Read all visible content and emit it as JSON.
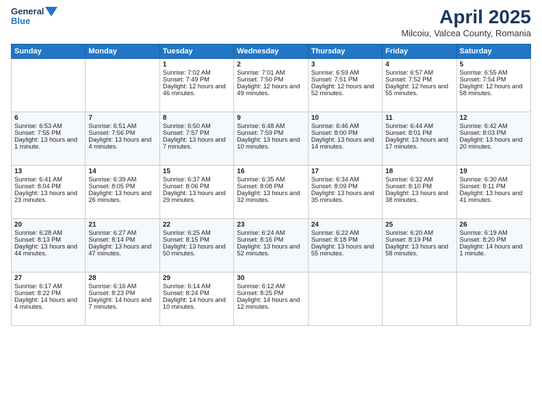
{
  "logo": {
    "line1": "General",
    "line2": "Blue"
  },
  "title": "April 2025",
  "location": "Milcoiu, Valcea County, Romania",
  "days_of_week": [
    "Sunday",
    "Monday",
    "Tuesday",
    "Wednesday",
    "Thursday",
    "Friday",
    "Saturday"
  ],
  "weeks": [
    [
      {
        "day": "",
        "sunrise": "",
        "sunset": "",
        "daylight": ""
      },
      {
        "day": "",
        "sunrise": "",
        "sunset": "",
        "daylight": ""
      },
      {
        "day": "1",
        "sunrise": "Sunrise: 7:02 AM",
        "sunset": "Sunset: 7:49 PM",
        "daylight": "Daylight: 12 hours and 46 minutes."
      },
      {
        "day": "2",
        "sunrise": "Sunrise: 7:01 AM",
        "sunset": "Sunset: 7:50 PM",
        "daylight": "Daylight: 12 hours and 49 minutes."
      },
      {
        "day": "3",
        "sunrise": "Sunrise: 6:59 AM",
        "sunset": "Sunset: 7:51 PM",
        "daylight": "Daylight: 12 hours and 52 minutes."
      },
      {
        "day": "4",
        "sunrise": "Sunrise: 6:57 AM",
        "sunset": "Sunset: 7:52 PM",
        "daylight": "Daylight: 12 hours and 55 minutes."
      },
      {
        "day": "5",
        "sunrise": "Sunrise: 6:55 AM",
        "sunset": "Sunset: 7:54 PM",
        "daylight": "Daylight: 12 hours and 58 minutes."
      }
    ],
    [
      {
        "day": "6",
        "sunrise": "Sunrise: 6:53 AM",
        "sunset": "Sunset: 7:55 PM",
        "daylight": "Daylight: 13 hours and 1 minute."
      },
      {
        "day": "7",
        "sunrise": "Sunrise: 6:51 AM",
        "sunset": "Sunset: 7:56 PM",
        "daylight": "Daylight: 13 hours and 4 minutes."
      },
      {
        "day": "8",
        "sunrise": "Sunrise: 6:50 AM",
        "sunset": "Sunset: 7:57 PM",
        "daylight": "Daylight: 13 hours and 7 minutes."
      },
      {
        "day": "9",
        "sunrise": "Sunrise: 6:48 AM",
        "sunset": "Sunset: 7:59 PM",
        "daylight": "Daylight: 13 hours and 10 minutes."
      },
      {
        "day": "10",
        "sunrise": "Sunrise: 6:46 AM",
        "sunset": "Sunset: 8:00 PM",
        "daylight": "Daylight: 13 hours and 14 minutes."
      },
      {
        "day": "11",
        "sunrise": "Sunrise: 6:44 AM",
        "sunset": "Sunset: 8:01 PM",
        "daylight": "Daylight: 13 hours and 17 minutes."
      },
      {
        "day": "12",
        "sunrise": "Sunrise: 6:42 AM",
        "sunset": "Sunset: 8:03 PM",
        "daylight": "Daylight: 13 hours and 20 minutes."
      }
    ],
    [
      {
        "day": "13",
        "sunrise": "Sunrise: 6:41 AM",
        "sunset": "Sunset: 8:04 PM",
        "daylight": "Daylight: 13 hours and 23 minutes."
      },
      {
        "day": "14",
        "sunrise": "Sunrise: 6:39 AM",
        "sunset": "Sunset: 8:05 PM",
        "daylight": "Daylight: 13 hours and 26 minutes."
      },
      {
        "day": "15",
        "sunrise": "Sunrise: 6:37 AM",
        "sunset": "Sunset: 8:06 PM",
        "daylight": "Daylight: 13 hours and 29 minutes."
      },
      {
        "day": "16",
        "sunrise": "Sunrise: 6:35 AM",
        "sunset": "Sunset: 8:08 PM",
        "daylight": "Daylight: 13 hours and 32 minutes."
      },
      {
        "day": "17",
        "sunrise": "Sunrise: 6:34 AM",
        "sunset": "Sunset: 8:09 PM",
        "daylight": "Daylight: 13 hours and 35 minutes."
      },
      {
        "day": "18",
        "sunrise": "Sunrise: 6:32 AM",
        "sunset": "Sunset: 8:10 PM",
        "daylight": "Daylight: 13 hours and 38 minutes."
      },
      {
        "day": "19",
        "sunrise": "Sunrise: 6:30 AM",
        "sunset": "Sunset: 8:11 PM",
        "daylight": "Daylight: 13 hours and 41 minutes."
      }
    ],
    [
      {
        "day": "20",
        "sunrise": "Sunrise: 6:28 AM",
        "sunset": "Sunset: 8:13 PM",
        "daylight": "Daylight: 13 hours and 44 minutes."
      },
      {
        "day": "21",
        "sunrise": "Sunrise: 6:27 AM",
        "sunset": "Sunset: 8:14 PM",
        "daylight": "Daylight: 13 hours and 47 minutes."
      },
      {
        "day": "22",
        "sunrise": "Sunrise: 6:25 AM",
        "sunset": "Sunset: 8:15 PM",
        "daylight": "Daylight: 13 hours and 50 minutes."
      },
      {
        "day": "23",
        "sunrise": "Sunrise: 6:24 AM",
        "sunset": "Sunset: 8:16 PM",
        "daylight": "Daylight: 13 hours and 52 minutes."
      },
      {
        "day": "24",
        "sunrise": "Sunrise: 6:22 AM",
        "sunset": "Sunset: 8:18 PM",
        "daylight": "Daylight: 13 hours and 55 minutes."
      },
      {
        "day": "25",
        "sunrise": "Sunrise: 6:20 AM",
        "sunset": "Sunset: 8:19 PM",
        "daylight": "Daylight: 13 hours and 58 minutes."
      },
      {
        "day": "26",
        "sunrise": "Sunrise: 6:19 AM",
        "sunset": "Sunset: 8:20 PM",
        "daylight": "Daylight: 14 hours and 1 minute."
      }
    ],
    [
      {
        "day": "27",
        "sunrise": "Sunrise: 6:17 AM",
        "sunset": "Sunset: 8:22 PM",
        "daylight": "Daylight: 14 hours and 4 minutes."
      },
      {
        "day": "28",
        "sunrise": "Sunrise: 6:16 AM",
        "sunset": "Sunset: 8:23 PM",
        "daylight": "Daylight: 14 hours and 7 minutes."
      },
      {
        "day": "29",
        "sunrise": "Sunrise: 6:14 AM",
        "sunset": "Sunset: 8:24 PM",
        "daylight": "Daylight: 14 hours and 10 minutes."
      },
      {
        "day": "30",
        "sunrise": "Sunrise: 6:12 AM",
        "sunset": "Sunset: 8:25 PM",
        "daylight": "Daylight: 14 hours and 12 minutes."
      },
      {
        "day": "",
        "sunrise": "",
        "sunset": "",
        "daylight": ""
      },
      {
        "day": "",
        "sunrise": "",
        "sunset": "",
        "daylight": ""
      },
      {
        "day": "",
        "sunrise": "",
        "sunset": "",
        "daylight": ""
      }
    ]
  ]
}
